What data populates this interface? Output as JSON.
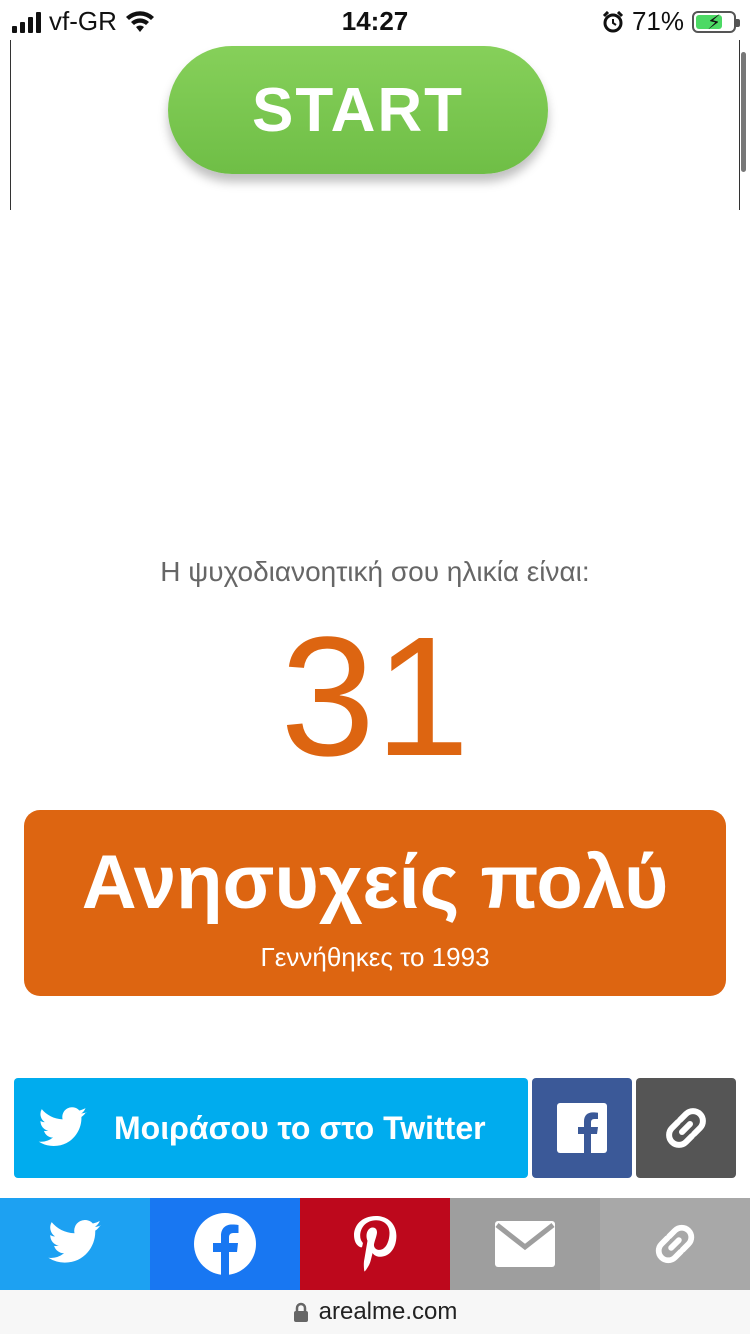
{
  "status_bar": {
    "carrier": "vf-GR",
    "time": "14:27",
    "battery": "71%",
    "battery_level": 0.71
  },
  "game": {
    "start_label": "START",
    "start_color": "#7ac74f"
  },
  "result": {
    "caption": "Η ψυχοδιανοητική σου ηλικία είναι:",
    "age": "31",
    "accent_color": "#dd6511",
    "verdict_title": "Ανησυχείς πολύ",
    "verdict_subtitle": "Γεννήθηκες το 1993"
  },
  "share": {
    "twitter_label": "Μοιράσου το στο Twitter",
    "twitter_icon": "twitter-bird-icon",
    "facebook_icon": "facebook-icon",
    "link_icon": "link-icon"
  },
  "bottom_bar": {
    "items": [
      "twitter-icon",
      "facebook-icon",
      "pinterest-icon",
      "mail-icon",
      "link-icon"
    ]
  },
  "url_bar": {
    "domain": "arealme.com"
  }
}
